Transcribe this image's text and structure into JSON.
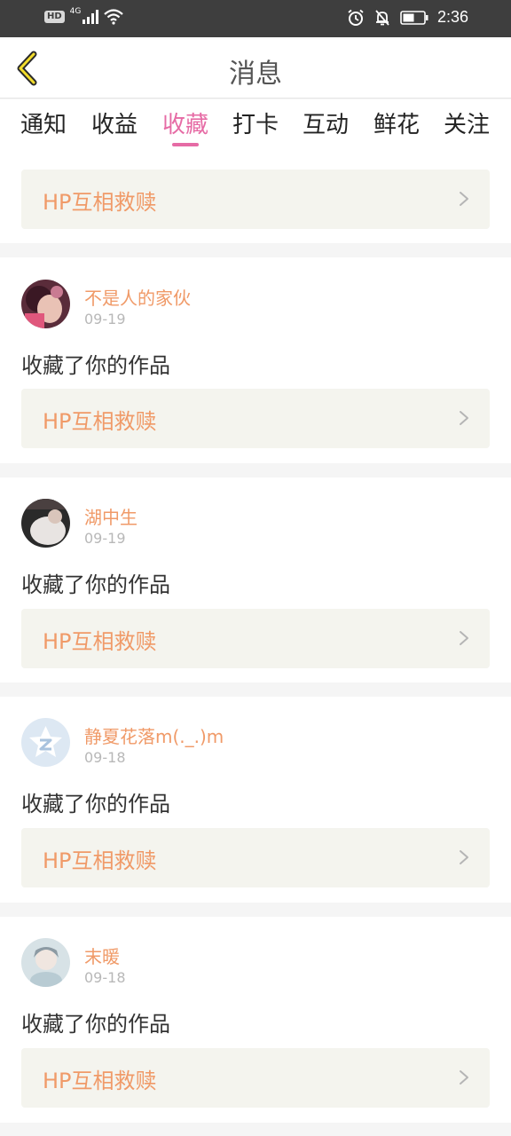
{
  "status_bar": {
    "hd": "HD",
    "network": "4G",
    "time": "2:36"
  },
  "nav": {
    "title": "消息"
  },
  "tabs": [
    {
      "label": "通知"
    },
    {
      "label": "收益"
    },
    {
      "label": "收藏"
    },
    {
      "label": "打卡"
    },
    {
      "label": "互动"
    },
    {
      "label": "鲜花"
    },
    {
      "label": "关注"
    }
  ],
  "active_tab": "收藏",
  "colors": {
    "accent": "#e66ba5",
    "username": "#f09a68",
    "work_title": "#f09a68"
  },
  "top_item": {
    "work_title": "HP互相救赎"
  },
  "messages": [
    {
      "username": "不是人的家伙",
      "date": "09-19",
      "action": "收藏了你的作品",
      "work_title": "HP互相救赎"
    },
    {
      "username": "湖中生",
      "date": "09-19",
      "action": "收藏了你的作品",
      "work_title": "HP互相救赎"
    },
    {
      "username": "静夏花落m(._.)m",
      "date": "09-18",
      "action": "收藏了你的作品",
      "work_title": "HP互相救赎"
    },
    {
      "username": "末暖",
      "date": "09-18",
      "action": "收藏了你的作品",
      "work_title": "HP互相救赎"
    }
  ]
}
